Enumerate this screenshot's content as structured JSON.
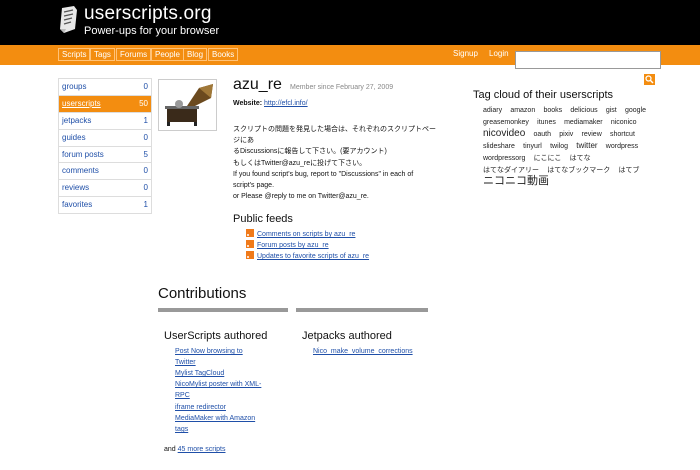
{
  "header": {
    "site_name": "userscripts.org",
    "tagline": "Power-ups for your browser"
  },
  "nav": {
    "items": [
      "Scripts",
      "Tags",
      "Forums",
      "People",
      "Blog",
      "Books"
    ],
    "signup": "Signup",
    "login": "Login",
    "search_value": ""
  },
  "sidebar": {
    "items": [
      {
        "label": "groups",
        "count": "0"
      },
      {
        "label": "userscripts",
        "count": "50"
      },
      {
        "label": "jetpacks",
        "count": "1"
      },
      {
        "label": "guides",
        "count": "0"
      },
      {
        "label": "forum posts",
        "count": "5"
      },
      {
        "label": "comments",
        "count": "0"
      },
      {
        "label": "reviews",
        "count": "0"
      },
      {
        "label": "favorites",
        "count": "1"
      }
    ],
    "active_index": 1
  },
  "profile": {
    "username": "azu_re",
    "member_since": "Member since February 27, 2009",
    "website_label": "Website:",
    "website_url": "http://efcl.info/",
    "bio_lines": [
      "スクリプトの問題を発見した場合は、それぞれのスクリプトページにあ",
      "るDiscussionsに報告して下さい。(要アカウント)",
      "もしくはTwitter@azu_reに投げて下さい。",
      "If you found script's bug, report to \"Discussions\" in each of",
      "script's page.",
      "or Please @reply to me on Twitter@azu_re."
    ]
  },
  "feeds": {
    "title": "Public feeds",
    "items": [
      "Comments on scripts by azu_re",
      "Forum posts by azu_re",
      "Updates to favorite scripts of azu_re"
    ]
  },
  "tag_cloud": {
    "title": "Tag cloud of their userscripts",
    "tags": [
      {
        "label": "adiary",
        "size": "s"
      },
      {
        "label": "amazon",
        "size": "s"
      },
      {
        "label": "books",
        "size": "s"
      },
      {
        "label": "delicious",
        "size": "s"
      },
      {
        "label": "gist",
        "size": "s"
      },
      {
        "label": "google",
        "size": "s"
      },
      {
        "label": "greasemonkey",
        "size": "s"
      },
      {
        "label": "itunes",
        "size": "s"
      },
      {
        "label": "mediamaker",
        "size": "s"
      },
      {
        "label": "niconico",
        "size": "s"
      },
      {
        "label": "nicovideo",
        "size": "l"
      },
      {
        "label": "oauth",
        "size": "s"
      },
      {
        "label": "pixiv",
        "size": "s"
      },
      {
        "label": "review",
        "size": "s"
      },
      {
        "label": "shortcut",
        "size": "s"
      },
      {
        "label": "slideshare",
        "size": "s"
      },
      {
        "label": "tinyurl",
        "size": "s"
      },
      {
        "label": "twilog",
        "size": "s"
      },
      {
        "label": "twitter",
        "size": "m"
      },
      {
        "label": "wordpress",
        "size": "s"
      },
      {
        "label": "wordpressorg",
        "size": "s"
      },
      {
        "label": "にこにこ",
        "size": "s"
      },
      {
        "label": "はてな",
        "size": "s"
      },
      {
        "label": "はてなダイアリー",
        "size": "s"
      },
      {
        "label": "はてなブックマーク",
        "size": "s"
      },
      {
        "label": "はてブ",
        "size": "s"
      },
      {
        "label": "ニコニコ動画",
        "size": "xl"
      }
    ]
  },
  "contributions": {
    "title": "Contributions",
    "userscripts_title": "UserScripts authored",
    "jetpacks_title": "Jetpacks authored",
    "userscripts": [
      [
        "Post Now browsing to",
        "Twitter"
      ],
      [
        "Mylist TagCloud"
      ],
      [
        "NicoMylist poster with XML-",
        "RPC"
      ],
      [
        "iframe redirector"
      ],
      [
        "MediaMaker with Amazon",
        "tags"
      ]
    ],
    "jetpacks": [
      "Nico_make_volume_corrections"
    ],
    "more_prefix": "and",
    "more_link": "45 more scripts"
  },
  "colors": {
    "accent": "#f38d10",
    "header_bg": "#000000",
    "link": "#1f4fa8"
  },
  "icons": {
    "logo": "script-scroll-icon",
    "search": "search-icon",
    "feed": "rss-icon",
    "avatar": "gramophone-image"
  }
}
